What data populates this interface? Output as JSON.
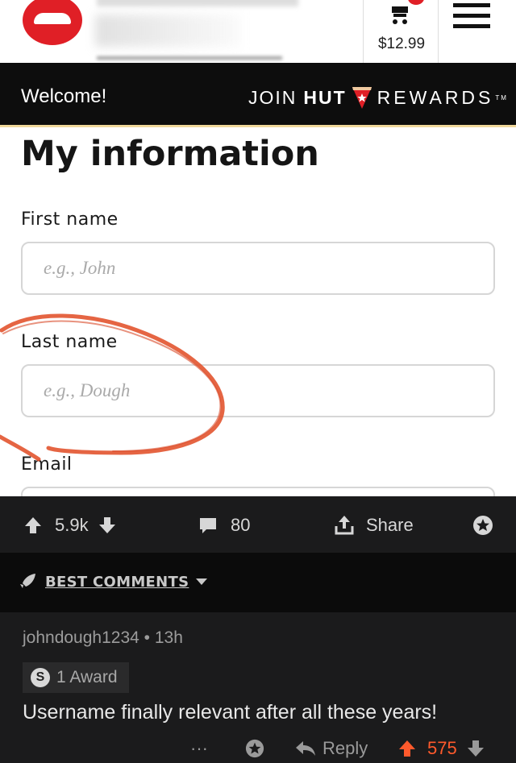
{
  "header": {
    "cart_price": "$12.99"
  },
  "banner": {
    "welcome": "Welcome!",
    "join": "JOIN",
    "hut": "HUT",
    "rewards": "REWARDS",
    "tm": "TM"
  },
  "form": {
    "title": "My information",
    "first_name_label": "First name",
    "first_name_placeholder": "e.g., John",
    "last_name_label": "Last name",
    "last_name_placeholder": "e.g., Dough",
    "email_label": "Email"
  },
  "post_actions": {
    "votes": "5.9k",
    "comments": "80",
    "share": "Share"
  },
  "comments": {
    "sort_label": "BEST COMMENTS",
    "items": [
      {
        "author": "johndough1234",
        "separator": "•",
        "age": "13h",
        "award": "1 Award",
        "award_coin": "S",
        "text": "Username finally relevant after all these years!",
        "more": "···",
        "reply": "Reply",
        "score": "575"
      }
    ]
  },
  "colors": {
    "brand_red": "#e01f26",
    "banner_bg": "#0d0d0d",
    "annotation_circle": "#e2542f",
    "reddit_bg": "#1b1b1c",
    "upvote_orange": "#ff5a2c"
  }
}
